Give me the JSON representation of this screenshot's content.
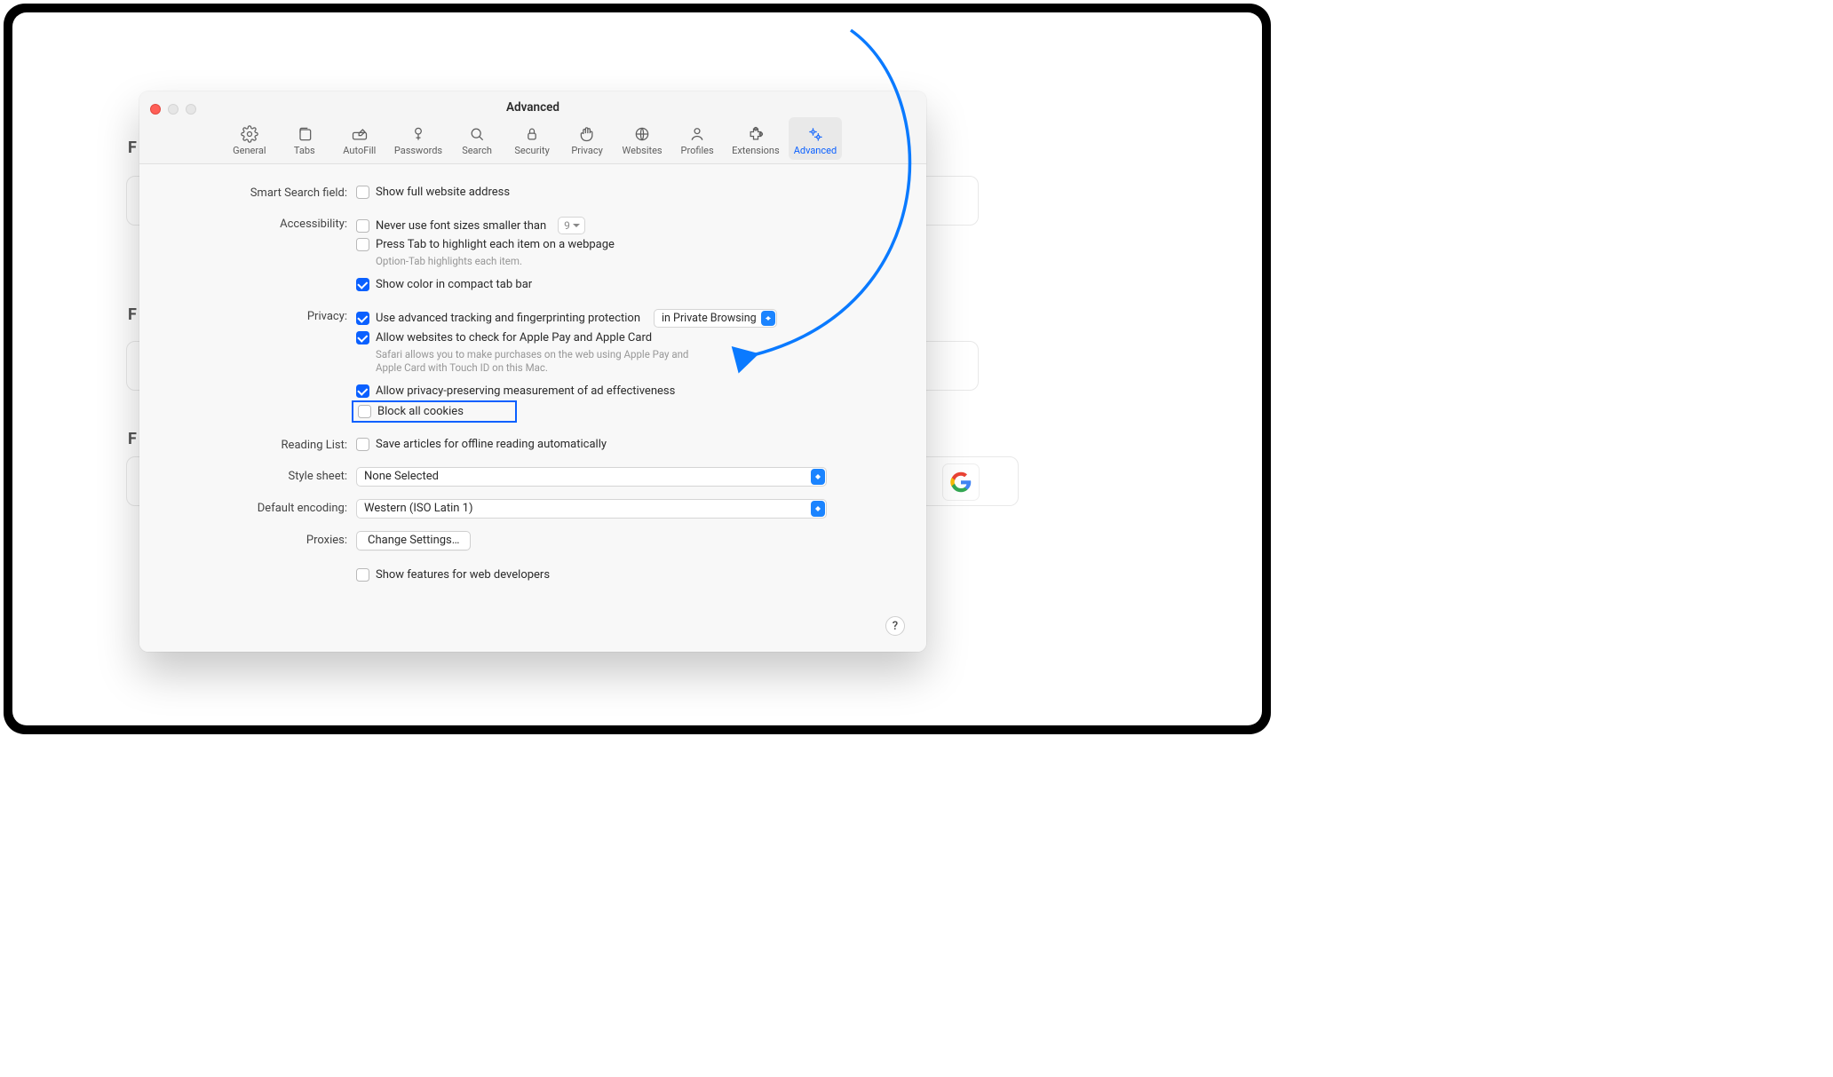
{
  "window": {
    "title": "Advanced"
  },
  "tabs": [
    {
      "key": "general",
      "label": "General"
    },
    {
      "key": "tabs",
      "label": "Tabs"
    },
    {
      "key": "autofill",
      "label": "AutoFill"
    },
    {
      "key": "passwords",
      "label": "Passwords"
    },
    {
      "key": "search",
      "label": "Search"
    },
    {
      "key": "security",
      "label": "Security"
    },
    {
      "key": "privacy",
      "label": "Privacy"
    },
    {
      "key": "websites",
      "label": "Websites"
    },
    {
      "key": "profiles",
      "label": "Profiles"
    },
    {
      "key": "extensions",
      "label": "Extensions"
    },
    {
      "key": "advanced",
      "label": "Advanced"
    }
  ],
  "sections": {
    "smartSearch": {
      "label": "Smart Search field:",
      "showFullAddress": {
        "checked": false,
        "text": "Show full website address"
      }
    },
    "accessibility": {
      "label": "Accessibility:",
      "minFont": {
        "checked": false,
        "text": "Never use font sizes smaller than",
        "value": "9"
      },
      "pressTab": {
        "checked": false,
        "text": "Press Tab to highlight each item on a webpage",
        "hint": "Option-Tab highlights each item."
      },
      "compactColor": {
        "checked": true,
        "text": "Show color in compact tab bar"
      }
    },
    "privacy": {
      "label": "Privacy:",
      "fingerprint": {
        "checked": true,
        "text": "Use advanced tracking and fingerprinting protection",
        "mode": "in Private Browsing"
      },
      "applePay": {
        "checked": true,
        "text": "Allow websites to check for Apple Pay and Apple Card",
        "hint": "Safari allows you to make purchases on the web using Apple Pay and Apple Card with Touch ID on this Mac."
      },
      "adMeasure": {
        "checked": true,
        "text": "Allow privacy-preserving measurement of ad effectiveness"
      },
      "blockCookies": {
        "checked": false,
        "text": "Block all cookies"
      }
    },
    "readingList": {
      "label": "Reading List:",
      "offline": {
        "checked": false,
        "text": "Save articles for offline reading automatically"
      }
    },
    "styleSheet": {
      "label": "Style sheet:",
      "value": "None Selected"
    },
    "encoding": {
      "label": "Default encoding:",
      "value": "Western (ISO Latin 1)"
    },
    "proxies": {
      "label": "Proxies:",
      "button": "Change Settings…"
    },
    "devFeatures": {
      "checked": false,
      "text": "Show features for web developers"
    }
  },
  "help": "?"
}
